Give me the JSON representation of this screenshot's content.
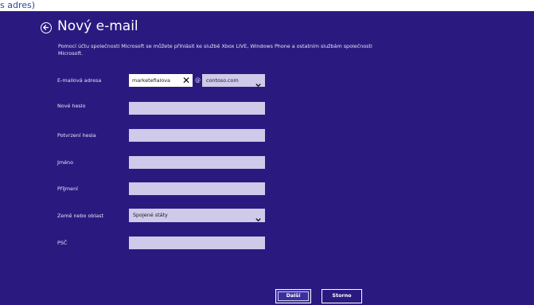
{
  "header": {
    "top_stub": "s adres)",
    "title": "Nový e-mail",
    "description": "Pomocí účtu společnosti Microsoft se můžete přihlásit ke službě Xbox LIVE, Windows Phone a ostatním službám společnosti Microsoft."
  },
  "form": {
    "email": {
      "label": "E-mailová adresa",
      "value": "marketefialova",
      "at": "@",
      "domain": "contoso.com"
    },
    "new_password": {
      "label": "Nové heslo",
      "value": ""
    },
    "confirm_password": {
      "label": "Potvrzení hesla",
      "value": ""
    },
    "first_name": {
      "label": "Jméno",
      "value": ""
    },
    "last_name": {
      "label": "Příjmení",
      "value": ""
    },
    "country": {
      "label": "Země nebo oblast",
      "value": "Spojené státy"
    },
    "postal_code": {
      "label": "PSČ",
      "value": ""
    }
  },
  "buttons": {
    "next": "Další",
    "cancel": "Storno"
  },
  "colors": {
    "background": "#2a1a80",
    "field": "#cfc9ea",
    "text": "#ffffff"
  }
}
